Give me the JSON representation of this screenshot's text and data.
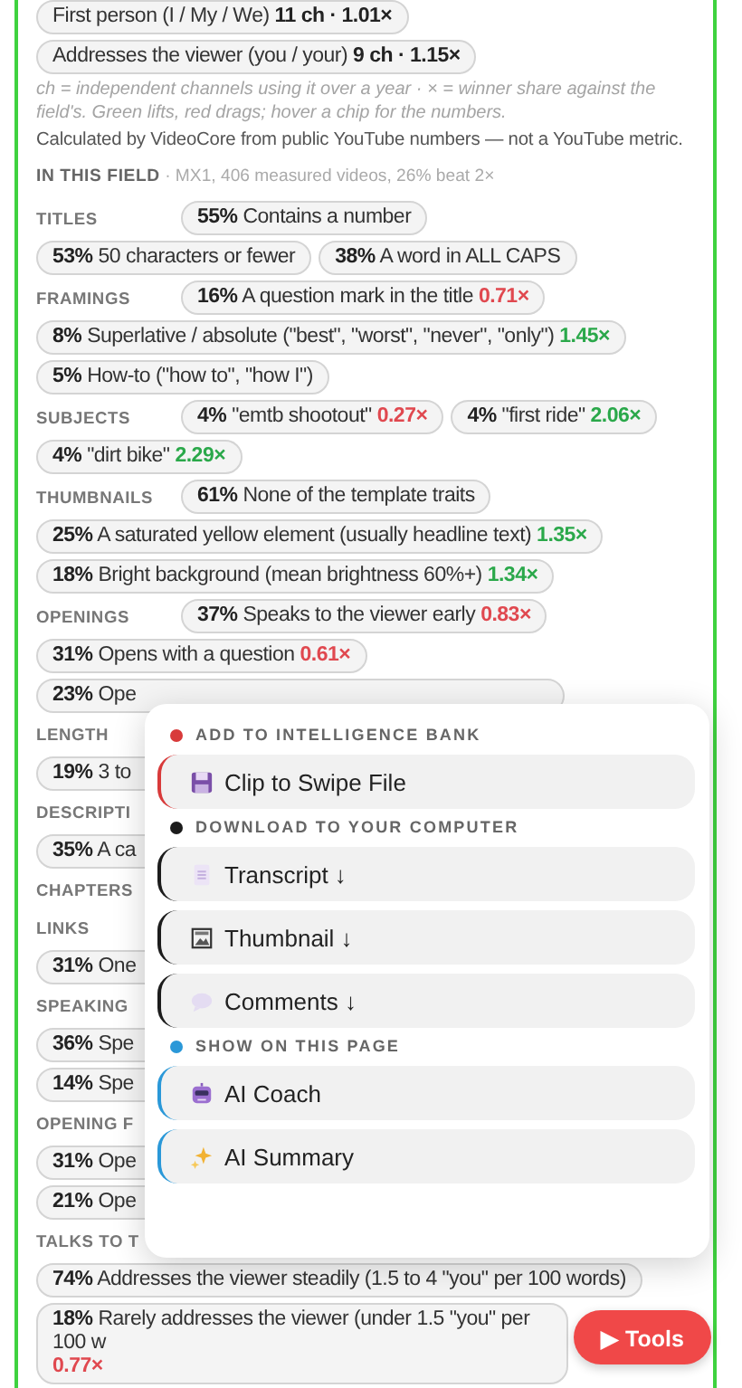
{
  "chips_top": [
    {
      "text": "First person (I / My / We) **11 ch · 1.01×**"
    },
    {
      "text": "Addresses the viewer (you / your) **9 ch · 1.15×**"
    }
  ],
  "note": "ch = independent channels using it over a year · × = winner share against the field's. Green lifts, red drags; hover a chip for the numbers.",
  "credit": "Calculated by VideoCore from public YouTube numbers — not a YouTube metric.",
  "field_heading": {
    "label": "IN THIS FIELD",
    "detail": "· MX1, 406 measured videos, 26% beat 2×"
  },
  "groups": [
    {
      "label": "TITLES",
      "chips": [
        {
          "text": "**55%** Contains a number"
        },
        {
          "text": "**53%** 50 characters or fewer"
        },
        {
          "text": "**38%** A word in ALL CAPS"
        }
      ]
    },
    {
      "label": "FRAMINGS",
      "chips": [
        {
          "text": "**16%** A question mark in the title",
          "mult": "0.71×",
          "color": "#e0484f"
        },
        {
          "text": "**8%** Superlative / absolute (\"best\", \"worst\", \"never\", \"only\")",
          "mult": "1.45×",
          "color": "#2aa84a"
        },
        {
          "text": "**5%** How-to (\"how to\", \"how I\")"
        }
      ]
    },
    {
      "label": "SUBJECTS",
      "chips": [
        {
          "text": "**4%** \"emtb shootout\"",
          "mult": "0.27×",
          "color": "#e0484f"
        },
        {
          "text": "**4%** \"first ride\"",
          "mult": "2.06×",
          "color": "#2aa84a"
        },
        {
          "text": "**4%** \"dirt bike\"",
          "mult": "2.29×",
          "color": "#2aa84a"
        }
      ]
    },
    {
      "label": "THUMBNAILS",
      "chips": [
        {
          "text": "**61%** None of the template traits"
        },
        {
          "text": "**25%** A saturated yellow element (usually headline text)",
          "mult": "1.35×",
          "color": "#2aa84a"
        },
        {
          "text": "**18%** Bright background (mean brightness 60%+)",
          "mult": "1.34×",
          "color": "#2aa84a"
        }
      ]
    },
    {
      "label": "OPENINGS",
      "chips": [
        {
          "text": "**37%** Speaks to the viewer early",
          "mult": "0.83×",
          "color": "#e0484f"
        },
        {
          "text": "**31%** Opens with a question",
          "mult": "0.61×",
          "color": "#e0484f"
        },
        {
          "text": "**23%** Ope",
          "kind": "cut"
        }
      ]
    },
    {
      "label": "LENGTH",
      "chips": [
        {
          "text": "**19%** 3 to",
          "kind": "cut"
        }
      ]
    },
    {
      "label": "DESCRIPTI",
      "chips": [
        {
          "text": "**35%** A ca",
          "kind": "cut"
        }
      ]
    },
    {
      "label": "CHAPTERS"
    },
    {
      "label": "LINKS",
      "chips": [
        {
          "text": "**31%** One",
          "kind": "cut"
        }
      ]
    },
    {
      "label": "SPEAKING",
      "chips": [
        {
          "text": "**36%** Spe",
          "kind": "cut"
        },
        {
          "text": "**14%** Spe",
          "kind": "cut"
        }
      ]
    },
    {
      "label": "OPENING F",
      "chips": [
        {
          "text": "**31%** Ope",
          "kind": "cut"
        },
        {
          "text": "**21%** Ope",
          "kind": "cut"
        }
      ]
    },
    {
      "label": "TALKS TO T",
      "chips": [
        {
          "text": "**74%** Addresses the viewer steadily (1.5 to 4 \"you\" per 100 words)"
        },
        {
          "text": "**18%** Rarely addresses the viewer (under 1.5 \"you\" per 100 w",
          "mult": "0.77×",
          "color": "#e0484f",
          "kind": "cut-end"
        }
      ]
    }
  ],
  "menu": {
    "sections": [
      {
        "title": "ADD TO INTELLIGENCE BANK",
        "color": "#d83a3a",
        "items": [
          {
            "label": "Clip to Swipe File"
          }
        ]
      },
      {
        "title": "DOWNLOAD TO YOUR COMPUTER",
        "color": "#1c1c1c",
        "items": [
          {
            "label": "Transcript ↓"
          },
          {
            "label": "Thumbnail ↓"
          },
          {
            "label": "Comments ↓"
          }
        ]
      },
      {
        "title": "SHOW ON THIS PAGE",
        "color": "#2a98d8",
        "items": [
          {
            "label": "AI Coach"
          },
          {
            "label": "AI Summary"
          }
        ]
      }
    ]
  },
  "tools_button": {
    "label": "▶ Tools"
  }
}
